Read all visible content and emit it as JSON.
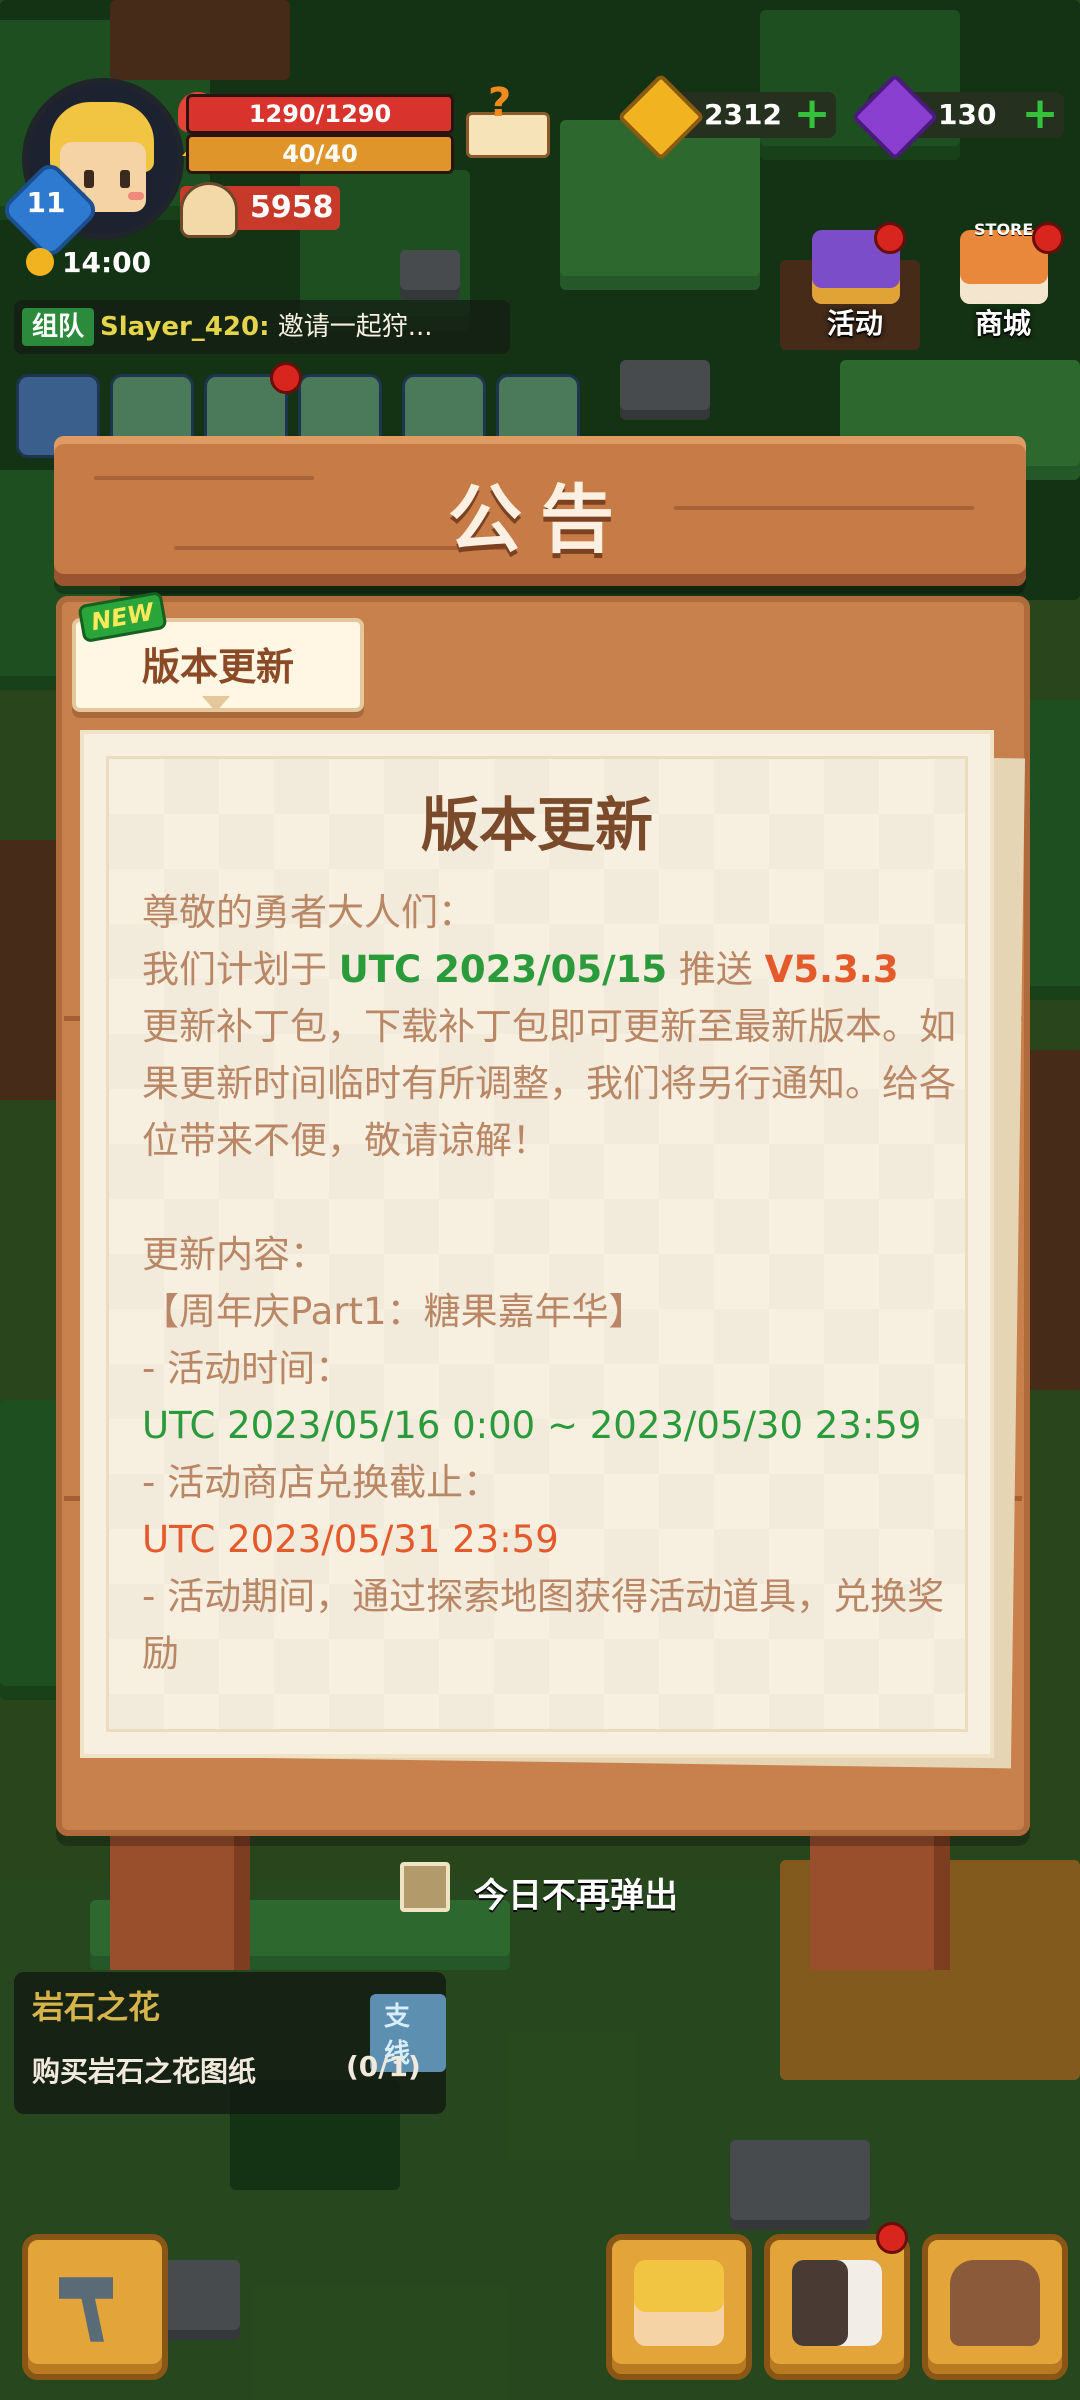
{
  "hud": {
    "level": "11",
    "hp": "1290/1290",
    "energy": "40/40",
    "power": "5958",
    "time": "14:00",
    "gold": "2312",
    "gems": "130",
    "activity_label": "活动",
    "shop_label": "商城",
    "store_sign": "STORE"
  },
  "chat": {
    "tag": "组队",
    "name": "Slayer_420:",
    "message": " 邀请一起狩..."
  },
  "notice": {
    "board_title": "公告",
    "new_badge": "NEW",
    "tab_label": "版本更新",
    "doc_title": "版本更新",
    "lines": {
      "l1": "尊敬的勇者大人们：",
      "l2a": "我们计划于 ",
      "l2_date": "UTC 2023/05/15",
      "l2b": " 推送 ",
      "l2_ver": "V5.3.3",
      "l3": "更新补丁包，下载补丁包即可更新至最新版本。如果更新时间临时有所调整，我们将另行通知。给各位带来不便，敬请谅解！",
      "l4": "更新内容：",
      "l5": "【周年庆Part1：糖果嘉年华】",
      "l6": "- 活动时间：",
      "l7": " UTC 2023/05/16 0:00 ~ 2023/05/30 23:59",
      "l8": "- 活动商店兑换截止：",
      "l9": "UTC 2023/05/31 23:59",
      "l10": "- 活动期间，通过探索地图获得活动道具，兑换奖励"
    },
    "dont_show_today": "今日不再弹出"
  },
  "quest": {
    "title": "岩石之花",
    "tag": "支线",
    "desc": "购买岩石之花图纸",
    "progress": "(0/1)"
  },
  "colors": {
    "accent_green": "#2a9a3b",
    "accent_red": "#e45a2a",
    "board_wood": "#c8804c",
    "paper": "#f7efdf"
  }
}
